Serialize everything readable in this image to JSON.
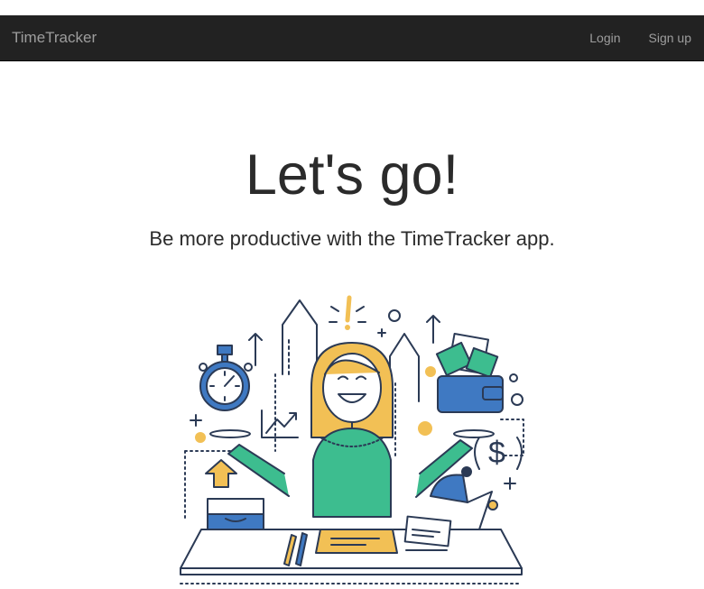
{
  "navbar": {
    "brand": "TimeTracker",
    "links": [
      {
        "label": "Login"
      },
      {
        "label": "Sign up"
      }
    ]
  },
  "hero": {
    "title": "Let's go!",
    "subtitle": "Be more productive with the TimeTracker app."
  },
  "illustration": {
    "name": "productive-woman-illustration",
    "colors": {
      "outline": "#2b3a55",
      "green": "#3dbd8f",
      "yellow": "#f2c055",
      "blue": "#3f79c2",
      "light": "#ffffff"
    }
  }
}
